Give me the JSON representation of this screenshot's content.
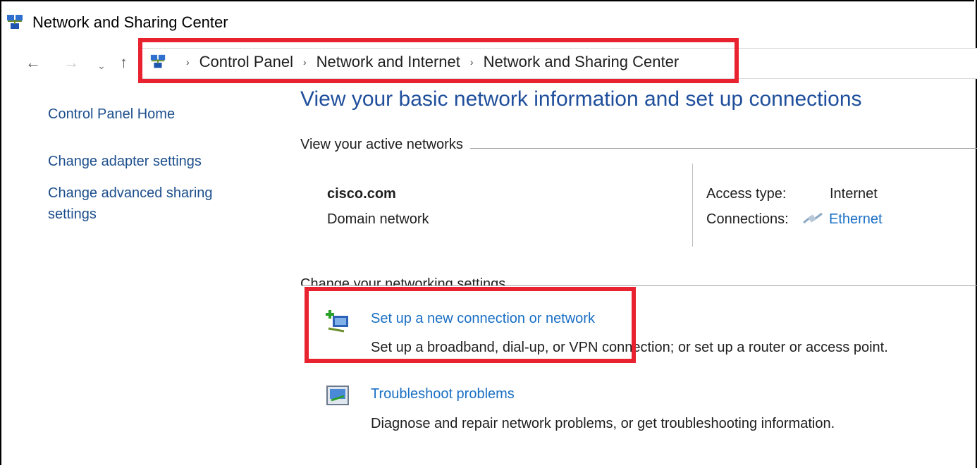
{
  "window": {
    "title": "Network and Sharing Center"
  },
  "nav": {
    "back": "←",
    "forward": "→",
    "recent": "⌄",
    "up": "↑"
  },
  "breadcrumb": [
    "Control Panel",
    "Network and Internet",
    "Network and Sharing Center"
  ],
  "sidebar": {
    "home": "Control Panel Home",
    "adapter": "Change adapter settings",
    "advanced_line1": "Change advanced sharing",
    "advanced_line2": "settings"
  },
  "main": {
    "title": "View your basic network information and set up connections",
    "active_networks_label": "View your active networks",
    "network_name": "cisco.com",
    "network_type": "Domain network",
    "access_type_label": "Access type:",
    "access_type_value": "Internet",
    "connections_label": "Connections:",
    "connections_value": "Ethernet",
    "change_settings_label": "Change your networking settings",
    "tasks": [
      {
        "title": "Set up a new connection or network",
        "desc": "Set up a broadband, dial-up, or VPN connection; or set up a router or access point."
      },
      {
        "title": "Troubleshoot problems",
        "desc": "Diagnose and repair network problems, or get troubleshooting information."
      }
    ]
  },
  "colors": {
    "link": "#1a6fc4",
    "title": "#1f4f9c",
    "highlight": "#e8232f"
  }
}
